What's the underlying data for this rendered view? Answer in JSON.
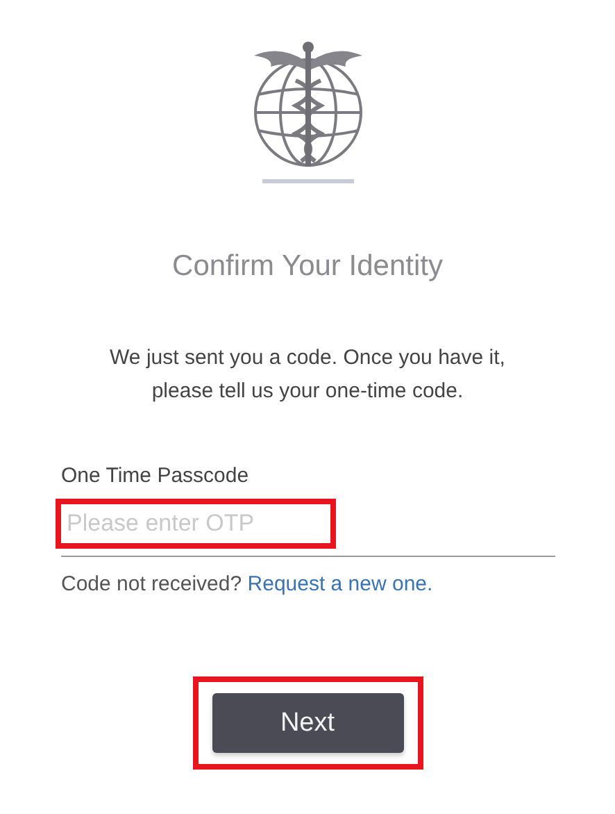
{
  "title": "Confirm Your Identity",
  "message": "We just sent you a code. Once you have it, please tell us your one-time code.",
  "otp_field": {
    "label": "One Time Passcode",
    "placeholder": "Please enter OTP",
    "highlighted": true
  },
  "resend": {
    "text": "Code not received?",
    "link": "Request a new one."
  },
  "next_button": {
    "label": "Next",
    "highlighted": true
  }
}
